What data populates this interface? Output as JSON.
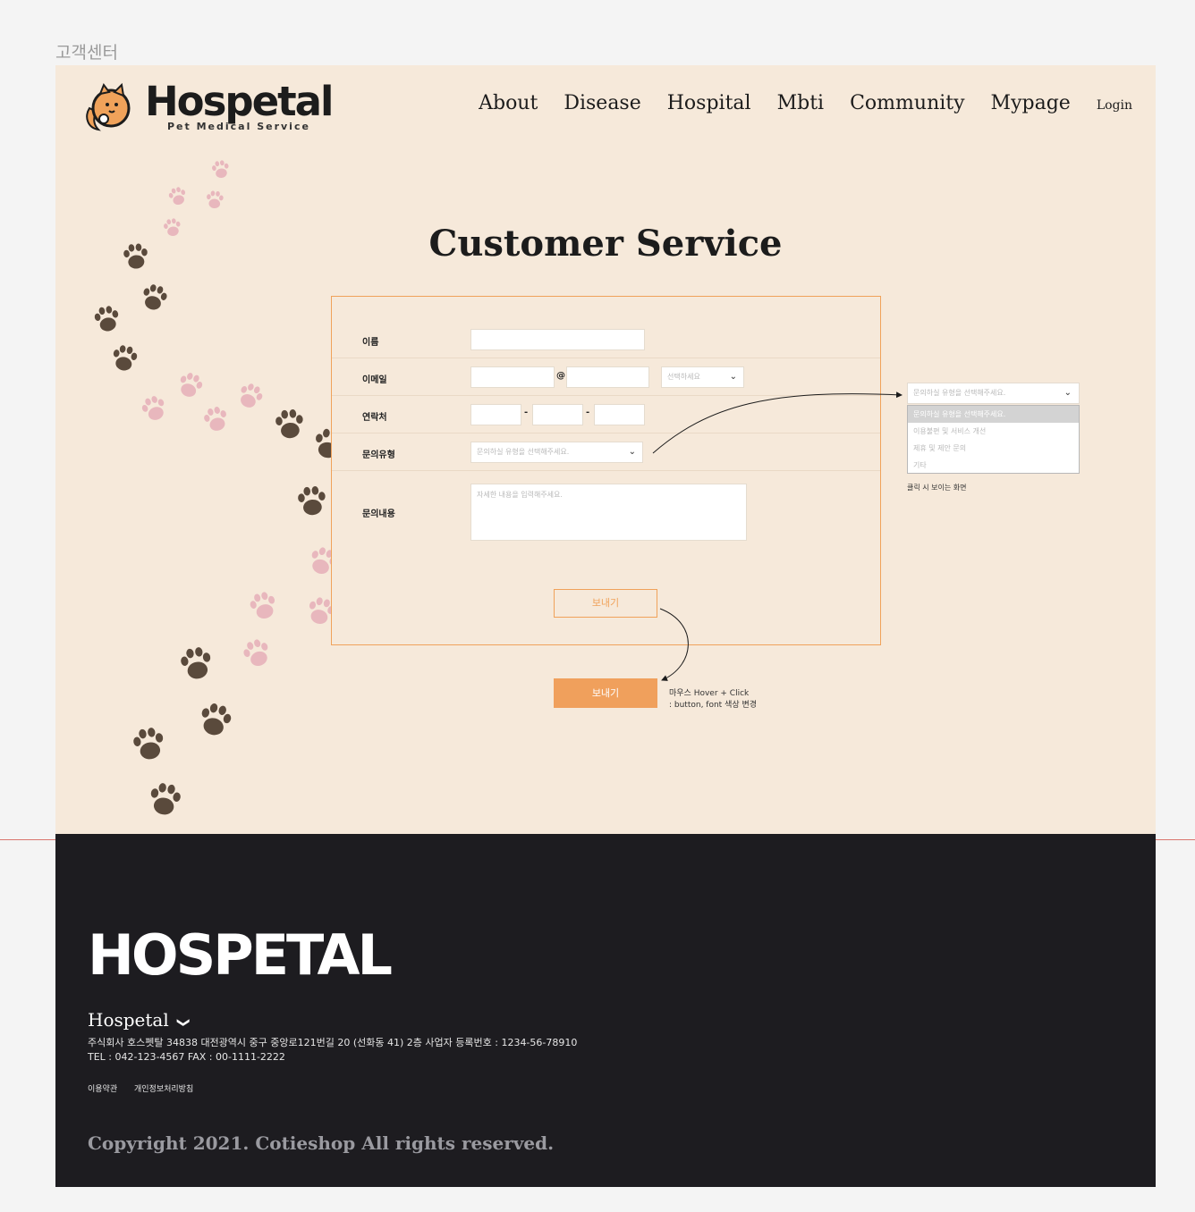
{
  "page_label": "고객센터",
  "header": {
    "logo_text": "Hospetal",
    "logo_subtitle": "Pet Medical Service",
    "nav": [
      "About",
      "Disease",
      "Hospital",
      "Mbti",
      "Community",
      "Mypage"
    ],
    "login": "Login"
  },
  "main": {
    "title": "Customer Service"
  },
  "form": {
    "name_label": "이름",
    "email_label": "이메일",
    "email_at": "@",
    "email_domain_select": "선택하세요",
    "phone_label": "연락처",
    "phone_sep": "-",
    "type_label": "문의유형",
    "type_placeholder": "문의하실 유형을 선택해주세요.",
    "content_label": "문의내용",
    "content_placeholder": "자세한 내용을 입력해주세요.",
    "send_label": "보내기"
  },
  "dropdown_preview": {
    "selected": "문의하실 유형을 선택해주세요.",
    "options": [
      "문의하실 유형을 선택해주세요.",
      "이용불편 및 서비스 개선",
      "제휴 및 제안 문의",
      "기타"
    ],
    "note": "클릭 시 보이는 화면"
  },
  "hover_button": {
    "label": "보내기",
    "note_line1": "마우스 Hover + Click",
    "note_line2": ": button, font 색상 변경"
  },
  "footer": {
    "logo_text": "HOSPETAL",
    "company": "Hospetal",
    "address": "주식회사 호스펫탈 34838 대전광역시 중구 중앙로121번길 20 (선화동 41) 2층  사업자 등록번호 : 1234-56-78910",
    "contact": "TEL : 042-123-4567 FAX : 00-1111-2222",
    "links": [
      "이용약관",
      "개인정보처리방침"
    ],
    "copyright": "Copyright 2021. Cotieshop All rights reserved."
  },
  "colors": {
    "accent": "#f0a25a",
    "background": "#f6e9da",
    "footer": "#1d1c20",
    "paw_dark": "#5a4a3c",
    "paw_pink": "#e8b7bd"
  }
}
